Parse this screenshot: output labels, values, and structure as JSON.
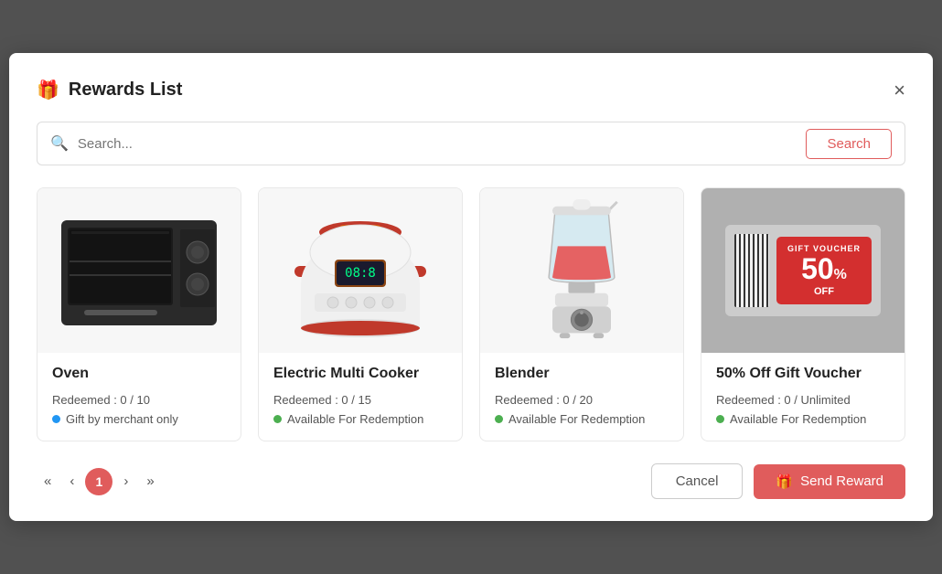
{
  "modal": {
    "title": "Rewards List",
    "close_label": "×"
  },
  "search": {
    "placeholder": "Search...",
    "button_label": "Search"
  },
  "cards": [
    {
      "id": "oven",
      "title": "Oven",
      "redeemed_text": "Redeemed : 0 / 10",
      "status_text": "Gift by merchant only",
      "status_color": "blue",
      "image_type": "oven"
    },
    {
      "id": "electric-multi-cooker",
      "title": "Electric Multi Cooker",
      "redeemed_text": "Redeemed : 0 / 15",
      "status_text": "Available For Redemption",
      "status_color": "green",
      "image_type": "cooker"
    },
    {
      "id": "blender",
      "title": "Blender",
      "redeemed_text": "Redeemed : 0 / 20",
      "status_text": "Available For Redemption",
      "status_color": "green",
      "image_type": "blender"
    },
    {
      "id": "voucher",
      "title": "50% Off Gift Voucher",
      "redeemed_text": "Redeemed : 0 / Unlimited",
      "status_text": "Available For Redemption",
      "status_color": "green",
      "image_type": "voucher"
    }
  ],
  "pagination": {
    "first_label": "«",
    "prev_label": "‹",
    "current": "1",
    "next_label": "›",
    "last_label": "»"
  },
  "footer": {
    "cancel_label": "Cancel",
    "send_label": "Send Reward"
  }
}
